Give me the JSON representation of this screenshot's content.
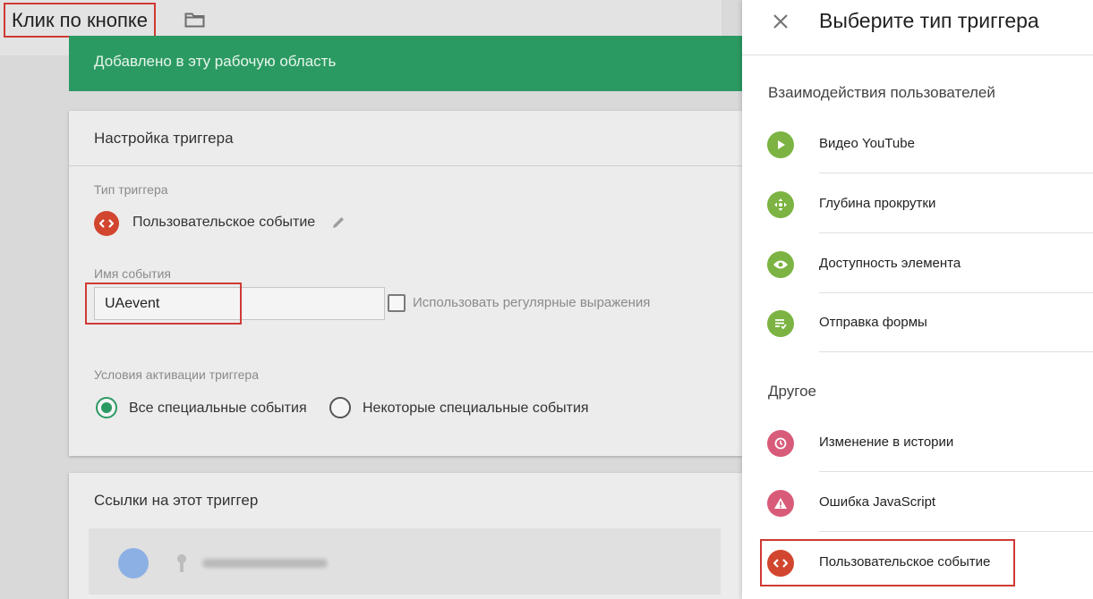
{
  "editor": {
    "title": "Клик по кнопке",
    "banner": "Добавлено в эту рабочую область",
    "settings": {
      "header": "Настройка триггера",
      "trigger_type_label": "Тип триггера",
      "trigger_type_value": "Пользовательское событие",
      "event_name_label": "Имя события",
      "event_name_value": "UAevent",
      "regex_label": "Использовать регулярные выражения",
      "regex_checked": false,
      "activation_label": "Условия активации триггера",
      "radio_all": "Все специальные события",
      "radio_some": "Некоторые специальные события",
      "selected": "all"
    },
    "references": {
      "header": "Ссылки на этот триггер"
    }
  },
  "panel": {
    "title": "Выберите тип триггера",
    "sections": [
      {
        "title": "Взаимодействия пользователей",
        "items": [
          {
            "label": "Видео YouTube",
            "icon": "play-icon",
            "color": "#7cb342"
          },
          {
            "label": "Глубина прокрутки",
            "icon": "move-arrows-icon",
            "color": "#7cb342"
          },
          {
            "label": "Доступность элемента",
            "icon": "eye-icon",
            "color": "#7cb342"
          },
          {
            "label": "Отправка формы",
            "icon": "form-icon",
            "color": "#7cb342"
          }
        ]
      },
      {
        "title": "Другое",
        "items": [
          {
            "label": "Изменение в истории",
            "icon": "history-icon",
            "color": "#d85c7a"
          },
          {
            "label": "Ошибка JavaScript",
            "icon": "warning-icon",
            "color": "#d85c7a"
          },
          {
            "label": "Пользовательское событие",
            "icon": "code-icon",
            "color": "#d2462f"
          }
        ]
      }
    ]
  },
  "colors": {
    "accent_green": "#2b9a62",
    "highlight_red": "#d03a34",
    "item_green": "#7cb342",
    "item_pink": "#d85c7a",
    "custom_event_red": "#d2462f"
  }
}
